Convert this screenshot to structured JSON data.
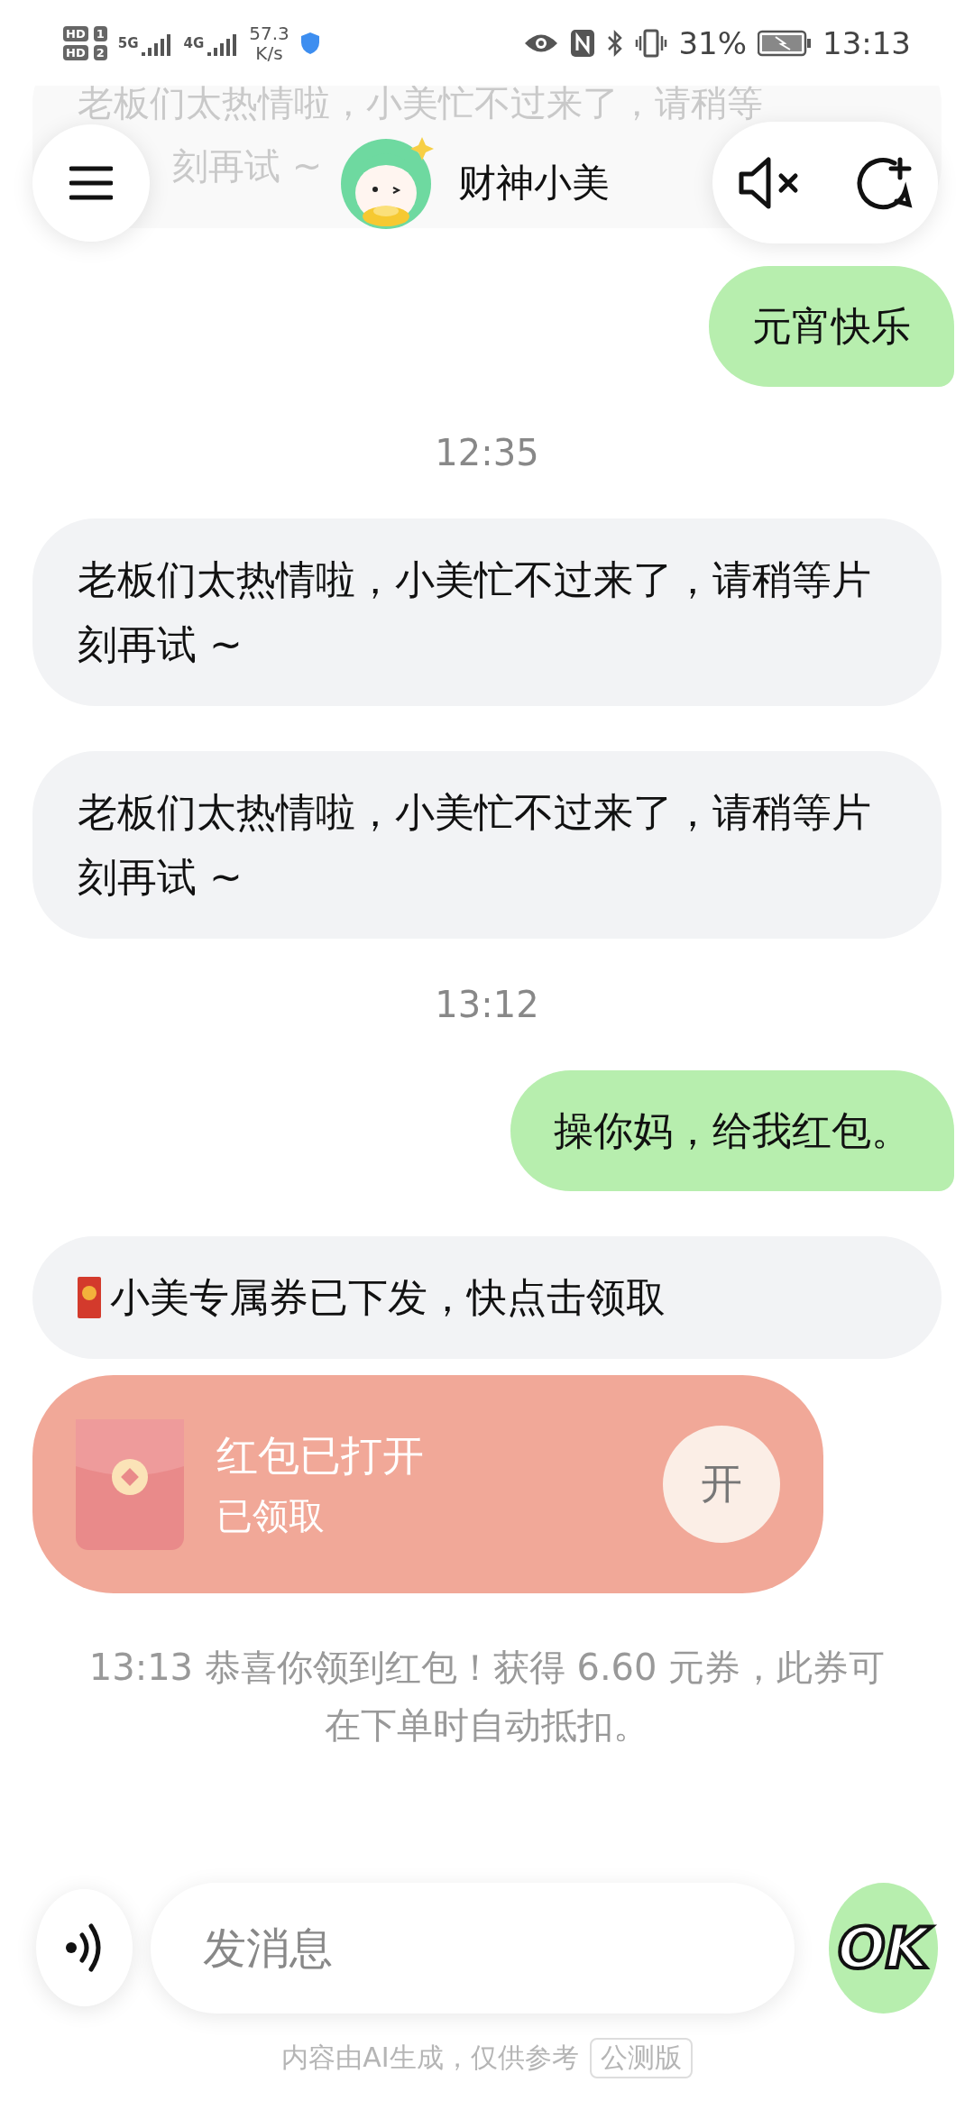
{
  "status_bar": {
    "sim_badges": [
      {
        "hd": "HD",
        "slot": "1",
        "network": "5G"
      },
      {
        "hd": "HD",
        "slot": "2",
        "network": "4G"
      }
    ],
    "speed_value": "57.3",
    "speed_unit": "K/s",
    "battery": "31%",
    "time": "13:13"
  },
  "header": {
    "title": "财神小美"
  },
  "faded_message": {
    "line_1": "老板们太热情啦，小美忙不过来了，请稍等",
    "line_2": "刻再试 ~"
  },
  "messages": [
    {
      "kind": "user",
      "text": "元宵快乐"
    },
    {
      "kind": "time",
      "text": "12:35"
    },
    {
      "kind": "bot",
      "text": "老板们太热情啦，小美忙不过来了，请稍等片刻再试 ~"
    },
    {
      "kind": "bot",
      "text": "老板们太热情啦，小美忙不过来了，请稍等片刻再试 ~"
    },
    {
      "kind": "time",
      "text": "13:12"
    },
    {
      "kind": "user",
      "text": "操你妈，给我红包。"
    },
    {
      "kind": "coupon",
      "text": "小美专属券已下发，快点击领取"
    },
    {
      "kind": "red_packet",
      "title": "红包已打开",
      "subtitle": "已领取",
      "button": "开",
      "opened": true
    },
    {
      "kind": "notice",
      "text": "13:13 恭喜你领到红包！获得 6.60 元券，此券可在下单时自动抵扣。"
    }
  ],
  "input": {
    "placeholder": "发消息",
    "send_label": "OK"
  },
  "footer": {
    "disclaimer": "内容由AI生成，仅供参考",
    "badge": "公测版"
  }
}
